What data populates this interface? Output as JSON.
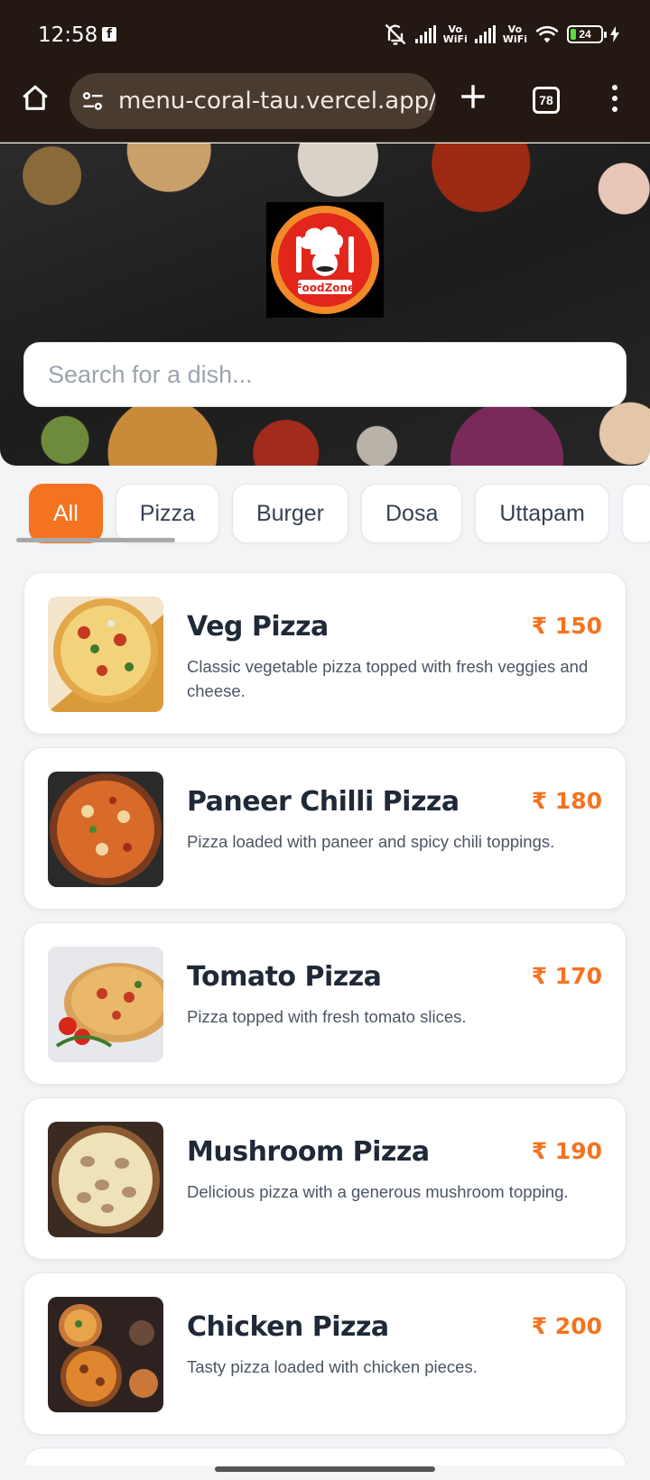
{
  "status_bar": {
    "time": "12:58",
    "app_icon": "f",
    "vowifi_label_1": "Vo\nWiFi",
    "vowifi_label_2": "Vo\nWiFi",
    "battery": "24"
  },
  "browser": {
    "url": "menu-coral-tau.vercel.app/m",
    "tab_count": "78"
  },
  "hero": {
    "logo_text": "FoodZone",
    "search_placeholder": "Search for a dish..."
  },
  "categories": [
    {
      "label": "All",
      "active": true
    },
    {
      "label": "Pizza",
      "active": false
    },
    {
      "label": "Burger",
      "active": false
    },
    {
      "label": "Dosa",
      "active": false
    },
    {
      "label": "Uttapam",
      "active": false
    }
  ],
  "dishes": [
    {
      "name": "Veg Pizza",
      "price": "₹ 150",
      "description": "Classic vegetable pizza topped with fresh veggies and cheese.",
      "image": "veg-pizza-image"
    },
    {
      "name": "Paneer Chilli Pizza",
      "price": "₹ 180",
      "description": "Pizza loaded with paneer and spicy chili toppings.",
      "image": "paneer-chilli-pizza-image"
    },
    {
      "name": "Tomato Pizza",
      "price": "₹ 170",
      "description": "Pizza topped with fresh tomato slices.",
      "image": "tomato-pizza-image"
    },
    {
      "name": "Mushroom Pizza",
      "price": "₹ 190",
      "description": "Delicious pizza with a generous mushroom topping.",
      "image": "mushroom-pizza-image"
    },
    {
      "name": "Chicken Pizza",
      "price": "₹ 200",
      "description": "Tasty pizza loaded with chicken pieces.",
      "image": "chicken-pizza-image"
    }
  ],
  "colors": {
    "accent": "#f47320",
    "browser_bg": "#231812",
    "page_bg": "#f3f4f6"
  }
}
